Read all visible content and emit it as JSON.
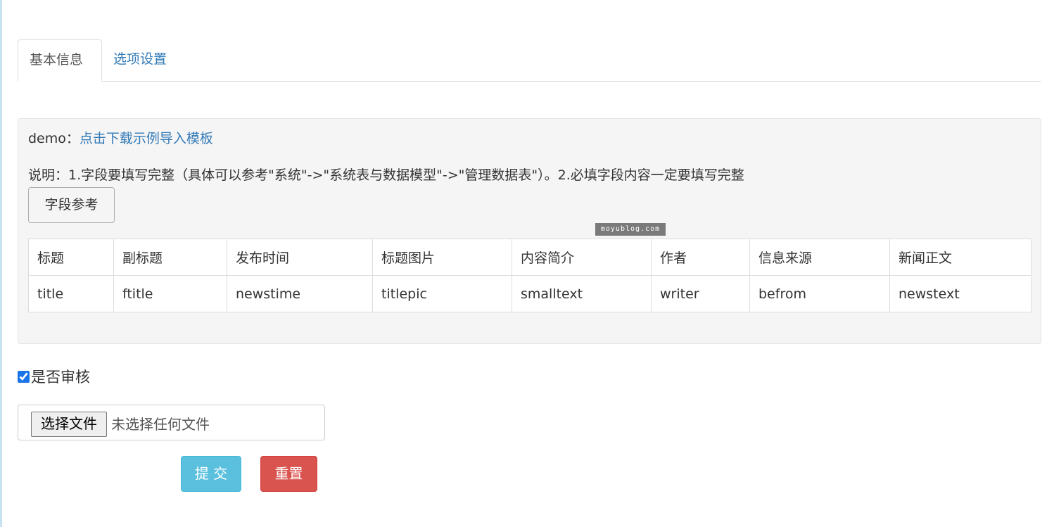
{
  "tabs": [
    {
      "label": "基本信息",
      "active": true
    },
    {
      "label": "选项设置",
      "active": false
    }
  ],
  "panel": {
    "demo_prefix": "demo：",
    "demo_link": "点击下载示例导入模板",
    "description": "说明：1.字段要填写完整（具体可以参考\"系统\"->\"系统表与数据模型\"->\"管理数据表\"）。2.必填字段内容一定要填写完整",
    "field_ref_button": "字段参考",
    "watermark": "moyublog.com",
    "table": {
      "headers": [
        "标题",
        "副标题",
        "发布时间",
        "标题图片",
        "内容简介",
        "作者",
        "信息来源",
        "新闻正文"
      ],
      "values": [
        "title",
        "ftitle",
        "newstime",
        "titlepic",
        "smalltext",
        "writer",
        "befrom",
        "newstext"
      ]
    }
  },
  "audit": {
    "label": "是否审核",
    "checked": true
  },
  "file_input": {
    "button_label": "选择文件",
    "status": "未选择任何文件"
  },
  "actions": {
    "submit_label": "提 交",
    "reset_label": "重置"
  },
  "colors": {
    "link": "#337ab7",
    "submit": "#5bc0de",
    "reset": "#d9534f",
    "panel_bg": "#f5f5f5"
  }
}
